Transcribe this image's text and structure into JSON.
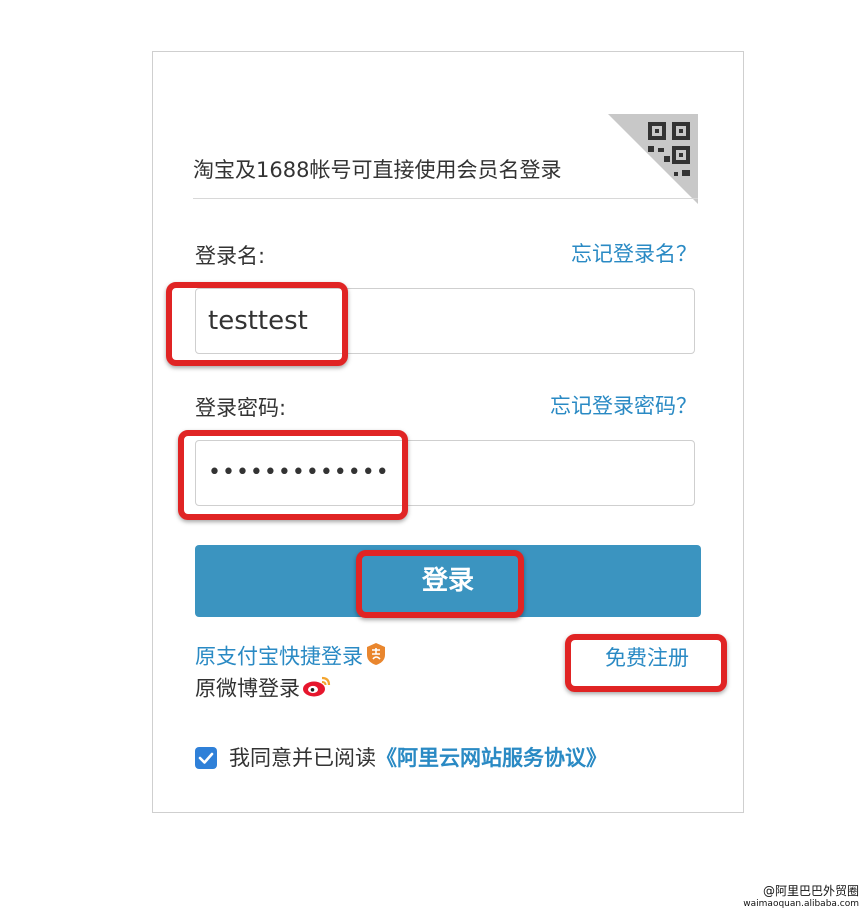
{
  "login": {
    "tip": "淘宝及1688帐号可直接使用会员名登录",
    "qr_icon": "qr-code-icon",
    "username_label": "登录名:",
    "forgot_username": "忘记登录名？",
    "username_value": "testtest",
    "password_label": "登录密码:",
    "forgot_password": "忘记登录密码？",
    "password_value": "•••••••••••••",
    "submit_label": "登录",
    "alipay_login": "原支付宝快捷登录",
    "weibo_login": "原微博登录",
    "register": "免费注册",
    "agree_prefix": "我同意并已阅读",
    "agree_link": "《阿里云网站服务协议》",
    "agree_checked": true
  },
  "colors": {
    "accent": "#3b94c0",
    "link": "#2a8ac4",
    "highlight": "#e02424"
  },
  "watermark": {
    "line1": "@阿里巴巴外贸圈",
    "line2": "waimaoquan.alibaba.com"
  }
}
